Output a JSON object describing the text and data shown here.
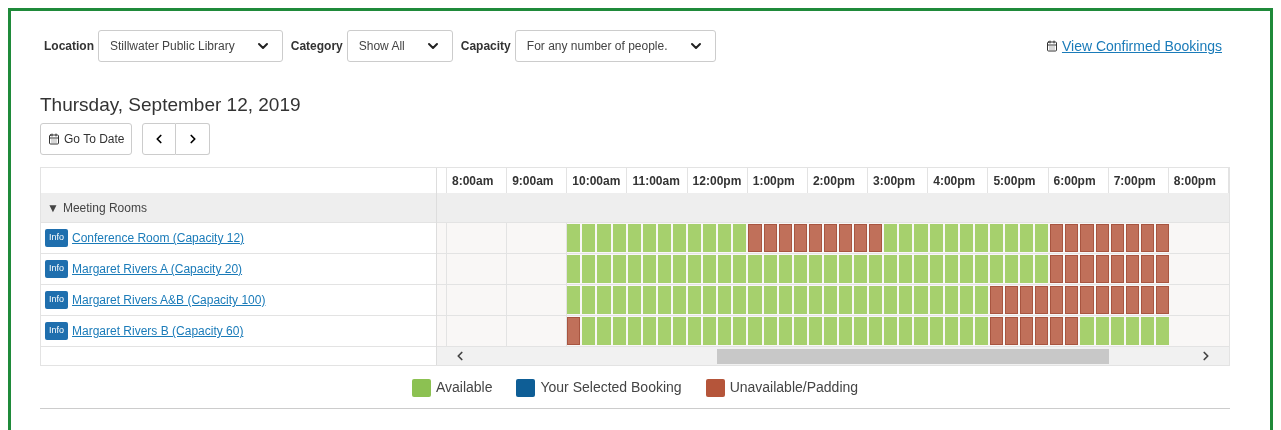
{
  "filters": [
    {
      "label": "Location",
      "value": "Stillwater Public Library"
    },
    {
      "label": "Category",
      "value": "Show All"
    },
    {
      "label": "Capacity",
      "value": "For any number of people."
    }
  ],
  "view_bookings_link": "View Confirmed Bookings",
  "date_title": "Thursday, September 12, 2019",
  "go_to_date_button": "Go To Date",
  "hours": [
    "8:00am",
    "9:00am",
    "10:00am",
    "11:00am",
    "12:00pm",
    "1:00pm",
    "2:00pm",
    "3:00pm",
    "4:00pm",
    "5:00pm",
    "6:00pm",
    "7:00pm",
    "8:00pm"
  ],
  "group": {
    "toggle": "▼",
    "name": "Meeting Rooms",
    "expanded": true
  },
  "rooms": [
    {
      "info": "Info",
      "name": "Conference Room (Capacity 12)",
      "slots": [
        {
          "available": true
        },
        {
          "available": true
        },
        {
          "available": true
        },
        {
          "available": true
        },
        {
          "available": true
        },
        {
          "available": true
        },
        {
          "available": true
        },
        {
          "available": true
        },
        {
          "available": true
        },
        {
          "available": true
        },
        {
          "available": true
        },
        {
          "available": true
        },
        {
          "available": false
        },
        {
          "available": false
        },
        {
          "available": false
        },
        {
          "available": false
        },
        {
          "available": false
        },
        {
          "available": false
        },
        {
          "available": false
        },
        {
          "available": false
        },
        {
          "available": false
        },
        {
          "available": true
        },
        {
          "available": true
        },
        {
          "available": true
        },
        {
          "available": true
        },
        {
          "available": true
        },
        {
          "available": true
        },
        {
          "available": true
        },
        {
          "available": true
        },
        {
          "available": true
        },
        {
          "available": true
        },
        {
          "available": true
        },
        {
          "available": false
        },
        {
          "available": false
        },
        {
          "available": false
        },
        {
          "available": false
        },
        {
          "available": false
        },
        {
          "available": false
        },
        {
          "available": false
        },
        {
          "available": false
        }
      ]
    },
    {
      "info": "Info",
      "name": "Margaret Rivers A (Capacity 20)",
      "slots": [
        {
          "available": true
        },
        {
          "available": true
        },
        {
          "available": true
        },
        {
          "available": true
        },
        {
          "available": true
        },
        {
          "available": true
        },
        {
          "available": true
        },
        {
          "available": true
        },
        {
          "available": true
        },
        {
          "available": true
        },
        {
          "available": true
        },
        {
          "available": true
        },
        {
          "available": true
        },
        {
          "available": true
        },
        {
          "available": true
        },
        {
          "available": true
        },
        {
          "available": true
        },
        {
          "available": true
        },
        {
          "available": true
        },
        {
          "available": true
        },
        {
          "available": true
        },
        {
          "available": true
        },
        {
          "available": true
        },
        {
          "available": true
        },
        {
          "available": true
        },
        {
          "available": true
        },
        {
          "available": true
        },
        {
          "available": true
        },
        {
          "available": true
        },
        {
          "available": true
        },
        {
          "available": true
        },
        {
          "available": true
        },
        {
          "available": false
        },
        {
          "available": false
        },
        {
          "available": false
        },
        {
          "available": false
        },
        {
          "available": false
        },
        {
          "available": false
        },
        {
          "available": false
        },
        {
          "available": false
        }
      ]
    },
    {
      "info": "Info",
      "name": "Margaret Rivers A&B (Capacity 100)",
      "slots": [
        {
          "available": true
        },
        {
          "available": true
        },
        {
          "available": true
        },
        {
          "available": true
        },
        {
          "available": true
        },
        {
          "available": true
        },
        {
          "available": true
        },
        {
          "available": true
        },
        {
          "available": true
        },
        {
          "available": true
        },
        {
          "available": true
        },
        {
          "available": true
        },
        {
          "available": true
        },
        {
          "available": true
        },
        {
          "available": true
        },
        {
          "available": true
        },
        {
          "available": true
        },
        {
          "available": true
        },
        {
          "available": true
        },
        {
          "available": true
        },
        {
          "available": true
        },
        {
          "available": true
        },
        {
          "available": true
        },
        {
          "available": true
        },
        {
          "available": true
        },
        {
          "available": true
        },
        {
          "available": true
        },
        {
          "available": true
        },
        {
          "available": false
        },
        {
          "available": false
        },
        {
          "available": false
        },
        {
          "available": false
        },
        {
          "available": false
        },
        {
          "available": false
        },
        {
          "available": false
        },
        {
          "available": false
        },
        {
          "available": false
        },
        {
          "available": false
        },
        {
          "available": false
        },
        {
          "available": false
        }
      ]
    },
    {
      "info": "Info",
      "name": "Margaret Rivers B (Capacity 60)",
      "slots": [
        {
          "available": false
        },
        {
          "available": true
        },
        {
          "available": true
        },
        {
          "available": true
        },
        {
          "available": true
        },
        {
          "available": true
        },
        {
          "available": true
        },
        {
          "available": true
        },
        {
          "available": true
        },
        {
          "available": true
        },
        {
          "available": true
        },
        {
          "available": true
        },
        {
          "available": true
        },
        {
          "available": true
        },
        {
          "available": true
        },
        {
          "available": true
        },
        {
          "available": true
        },
        {
          "available": true
        },
        {
          "available": true
        },
        {
          "available": true
        },
        {
          "available": true
        },
        {
          "available": true
        },
        {
          "available": true
        },
        {
          "available": true
        },
        {
          "available": true
        },
        {
          "available": true
        },
        {
          "available": true
        },
        {
          "available": true
        },
        {
          "available": false
        },
        {
          "available": false
        },
        {
          "available": false
        },
        {
          "available": false
        },
        {
          "available": false
        },
        {
          "available": false
        },
        {
          "available": true
        },
        {
          "available": true
        },
        {
          "available": true
        },
        {
          "available": true
        },
        {
          "available": true
        },
        {
          "available": true
        }
      ]
    }
  ],
  "legend": [
    {
      "label": "Available",
      "color": "#8cc152"
    },
    {
      "label": "Your Selected Booking",
      "color": "#0e5e96"
    },
    {
      "label": "Unavailable/Padding",
      "color": "#b5553a"
    }
  ]
}
